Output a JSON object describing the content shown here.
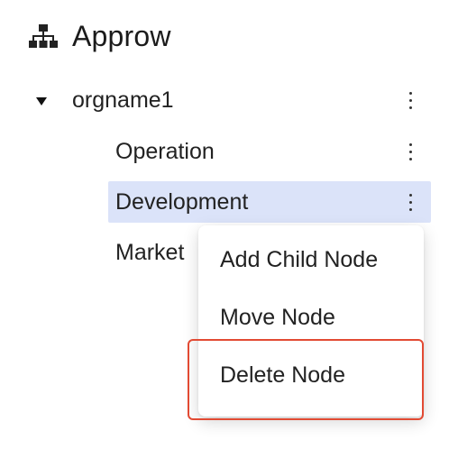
{
  "app": {
    "title": "Approw",
    "icon": "org-chart-icon"
  },
  "tree": {
    "root": {
      "label": "orgname1",
      "expanded": true
    },
    "children": [
      {
        "label": "Operation",
        "selected": false
      },
      {
        "label": "Development",
        "selected": true
      },
      {
        "label": "Market",
        "selected": false
      }
    ]
  },
  "context_menu": {
    "items": [
      {
        "label": "Add Child Node"
      },
      {
        "label": "Move Node"
      },
      {
        "label": "Delete Node",
        "highlighted": true
      }
    ]
  },
  "colors": {
    "selected_bg": "#dbe3f9",
    "highlight_border": "#e24a33"
  }
}
